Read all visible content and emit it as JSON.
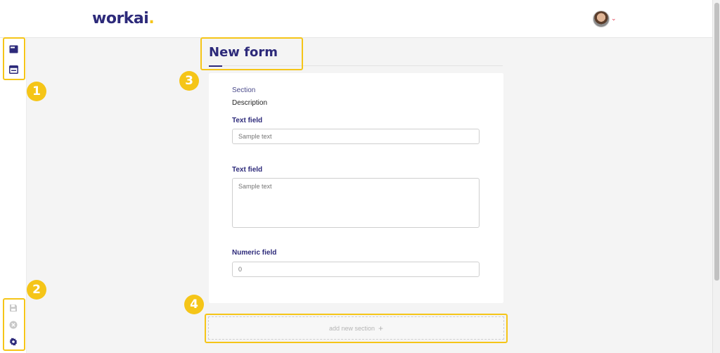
{
  "brand": {
    "name": "workai",
    "dot": "."
  },
  "header": {
    "avatar_caret": "⌄"
  },
  "badges": [
    "1",
    "2",
    "3",
    "4"
  ],
  "form": {
    "title": "New form",
    "section": {
      "label": "Section",
      "description": "Description"
    },
    "fields": [
      {
        "label": "Text field",
        "placeholder": "Sample text",
        "type": "text"
      },
      {
        "label": "Text field",
        "placeholder": "Sample text",
        "type": "textarea"
      },
      {
        "label": "Numeric field",
        "placeholder": "0",
        "type": "number"
      }
    ],
    "add_section_label": "add new section",
    "add_section_icon": "+"
  },
  "toolbar": {
    "top_icons": [
      "section-icon",
      "layout-icon"
    ],
    "bottom_icons": [
      "save-icon",
      "cancel-icon",
      "settings-icon"
    ]
  },
  "colors": {
    "accent": "#f5c518",
    "brand": "#2d2a7a",
    "caret": "#e0334a"
  }
}
